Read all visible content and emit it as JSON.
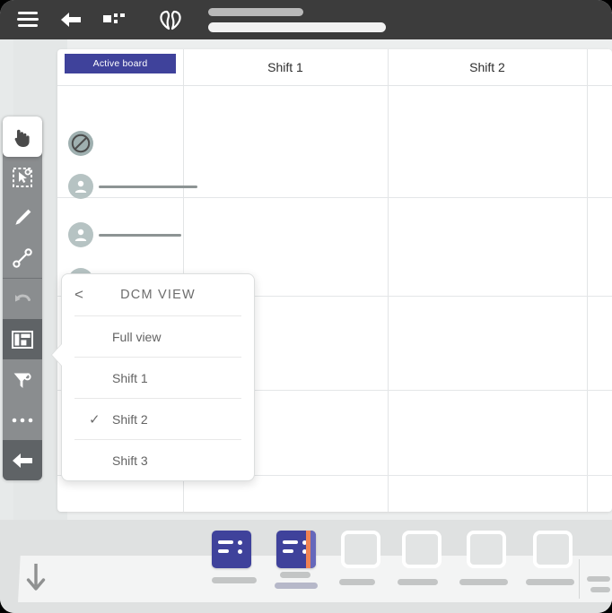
{
  "topbar": {
    "menu_icon": "hamburger-icon",
    "back_icon": "back-arrow-icon",
    "dashboard_icon": "dashboard-grid-icon",
    "logo_icon": "brand-logo-icon",
    "title_redacted": "",
    "subtitle_redacted": ""
  },
  "toolbar": {
    "items": [
      {
        "name": "pointer-tool",
        "icon": "hand-pointer-icon",
        "state": "active-light"
      },
      {
        "name": "select-tool",
        "icon": "lasso-select-icon",
        "state": "normal"
      },
      {
        "name": "pen-tool",
        "icon": "pen-icon",
        "state": "normal"
      },
      {
        "name": "connector-tool",
        "icon": "line-connector-icon",
        "state": "normal"
      },
      {
        "name": "undo-tool",
        "icon": "undo-arrow-icon",
        "state": "dim"
      },
      {
        "name": "board-view-tool",
        "icon": "board-layout-icon",
        "state": "active-dark"
      },
      {
        "name": "tag-tool",
        "icon": "tag-funnel-icon",
        "state": "normal"
      },
      {
        "name": "more-tool",
        "icon": "ellipsis-icon",
        "state": "normal"
      },
      {
        "name": "exit-tool",
        "icon": "exit-arrow-icon",
        "state": "last"
      }
    ]
  },
  "board": {
    "active_badge": "Active board",
    "columns": [
      "Shift 1",
      "Shift 2"
    ],
    "rows": [
      {
        "avatar": "blocked-avatar",
        "name_redacted": "",
        "line_width": 0
      },
      {
        "avatar": "person-avatar",
        "name_redacted": "",
        "line_width": 110
      },
      {
        "avatar": "person-avatar",
        "name_redacted": "",
        "line_width": 92
      },
      {
        "avatar": "person-avatar",
        "name_redacted": "",
        "line_width": 110
      },
      {
        "avatar": "person-avatar",
        "name_redacted": "",
        "line_width": 100
      },
      {
        "avatar": "person-avatar",
        "name_redacted": "",
        "line_width": 108
      }
    ]
  },
  "popup": {
    "back_label": "<",
    "title": "DCM VIEW",
    "items": [
      {
        "label": "Full view",
        "checked": false
      },
      {
        "label": "Shift 1",
        "checked": false
      },
      {
        "label": "Shift 2",
        "checked": true
      },
      {
        "label": "Shift 3",
        "checked": false
      }
    ],
    "check_glyph": "✓"
  },
  "dock": {
    "scroll_icon": "down-arrow-icon",
    "cards": [
      {
        "name": "card-thumb-1",
        "type": "filled",
        "stripe": false
      },
      {
        "name": "card-thumb-2",
        "type": "filled",
        "stripe": true
      },
      {
        "name": "card-thumb-3",
        "type": "empty",
        "stripe": false
      },
      {
        "name": "card-thumb-4",
        "type": "empty",
        "stripe": false
      },
      {
        "name": "card-thumb-5",
        "type": "empty",
        "stripe": false
      },
      {
        "name": "card-thumb-6",
        "type": "empty",
        "stripe": false
      }
    ]
  },
  "colors": {
    "accent_indigo": "#3f429b",
    "stripe_orange": "#ef8354",
    "stripe_purple": "#6568bb",
    "topbar_dark": "#3c3c3c",
    "toolbar_gray": "#8a8d8f",
    "toolbar_active": "#5f6366",
    "avatar_gray": "#b6c3c3",
    "canvas_gray": "#eceeee"
  }
}
